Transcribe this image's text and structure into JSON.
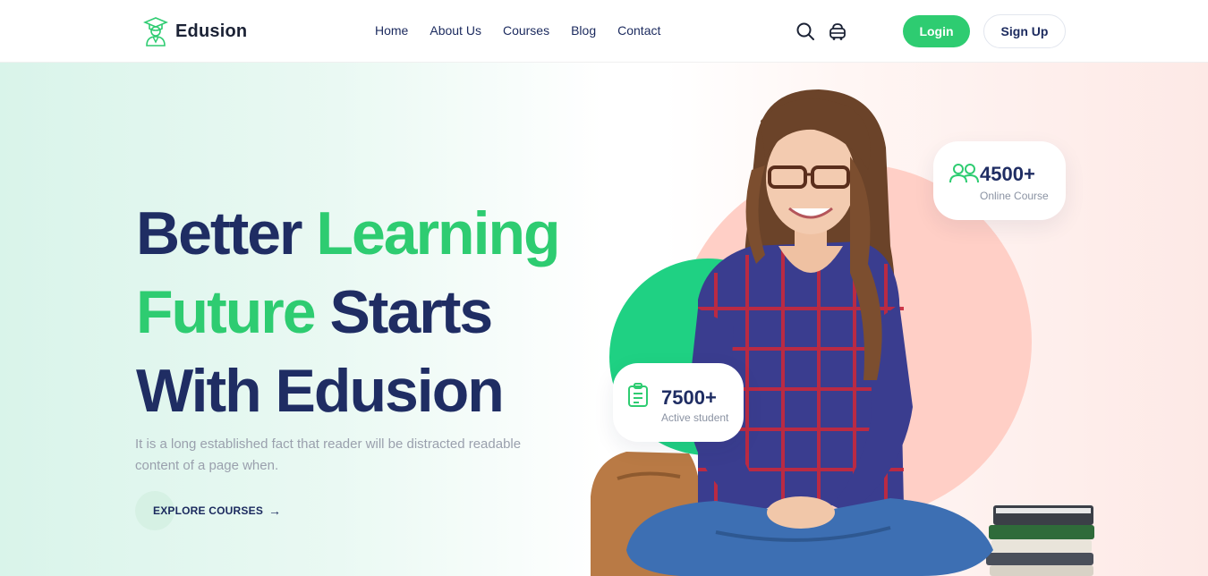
{
  "brand": {
    "name": "Edusion",
    "icon": "graduate-icon"
  },
  "nav": {
    "items": [
      {
        "label": "Home"
      },
      {
        "label": "About Us"
      },
      {
        "label": "Courses"
      },
      {
        "label": "Blog"
      },
      {
        "label": "Contact"
      }
    ]
  },
  "header": {
    "search_icon": "search-icon",
    "cart_icon": "cart-icon",
    "login_label": "Login",
    "signup_label": "Sign Up"
  },
  "hero": {
    "title_line1_a": "Better",
    "title_line1_b": "Learning",
    "title_line2_a": "Future",
    "title_line2_b": "Starts",
    "title_line3": "With Edusion",
    "subtitle": "It is a long established fact that reader will be distracted readable content of a page when.",
    "cta_label": "EXPLORE COURSES",
    "cta_icon": "arrow-right-icon"
  },
  "stats": {
    "online": {
      "value": "4500+",
      "label": "Online Course",
      "icon": "users-icon"
    },
    "active": {
      "value": "7500+",
      "label": "Active student",
      "icon": "clipboard-icon"
    }
  },
  "colors": {
    "accent_green": "#2ecc71",
    "navy": "#1f2d63",
    "pink_circle": "#ffcfc6",
    "green_circle": "#1fd183"
  }
}
